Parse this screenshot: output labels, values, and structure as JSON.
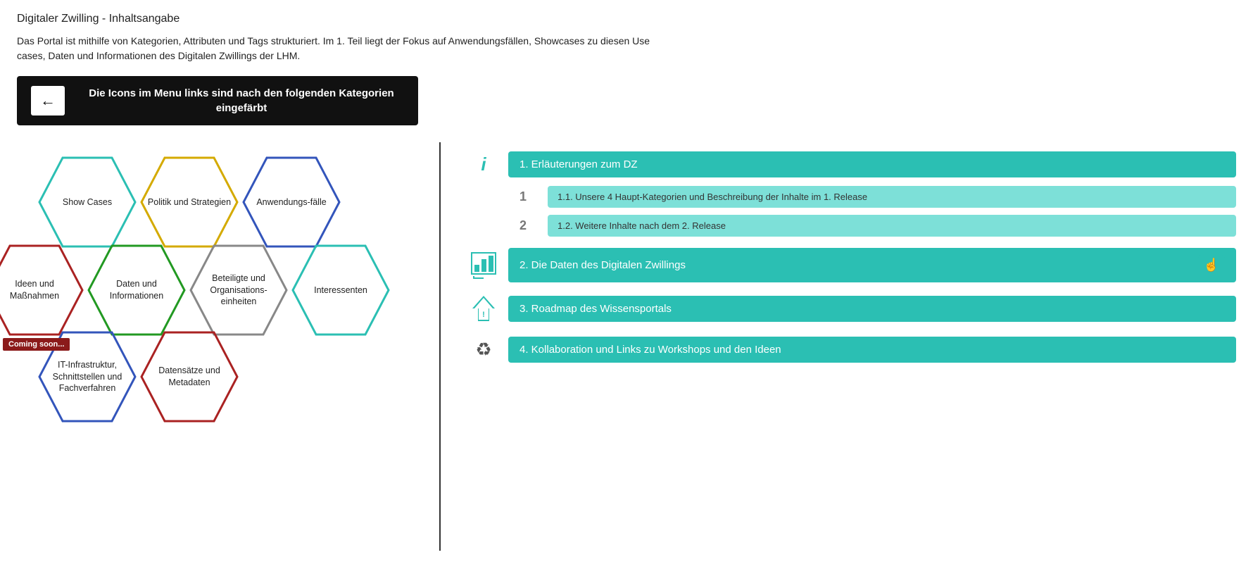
{
  "header": {
    "title": "Digitaler Zwilling - Inhaltsangabe"
  },
  "intro": {
    "text": "Das Portal ist mithilfe von Kategorien, Attributen und Tags strukturiert. Im 1. Teil liegt der Fokus auf Anwendungsfällen, Showcases zu diesen Use cases, Daten und Informationen des Digitalen Zwillings der LHM."
  },
  "banner": {
    "arrow_symbol": "←",
    "text": "Die Icons im Menu links sind nach den folgenden Kategorien eingefärbt"
  },
  "hexagons": [
    {
      "id": "show-cases",
      "label": "Show Cases",
      "color": "#2bbfb3",
      "filled": false
    },
    {
      "id": "politik",
      "label": "Politik und Strategien",
      "color": "#d4aa00",
      "filled": false
    },
    {
      "id": "anwendung",
      "label": "Anwendungs-fälle",
      "color": "#3355bb",
      "filled": false
    },
    {
      "id": "ideen",
      "label": "Ideen und Maßnahmen",
      "color": "#aa2222",
      "filled": false
    },
    {
      "id": "daten",
      "label": "Daten und Informationen",
      "color": "#229922",
      "filled": false
    },
    {
      "id": "beteiligte",
      "label": "Beteiligte und Organisations-einheiten",
      "color": "#888888",
      "filled": false
    },
    {
      "id": "interessenten",
      "label": "Interessenten",
      "color": "#2bbfb3",
      "filled": false
    },
    {
      "id": "it-infra",
      "label": "IT-Infrastruktur, Schnittstellen und Fachverfahren",
      "color": "#3355bb",
      "filled": false
    },
    {
      "id": "datensaetze",
      "label": "Datensätze und Metadaten",
      "color": "#aa2222",
      "filled": false
    }
  ],
  "coming_soon": "Coming soon...",
  "toc": {
    "items": [
      {
        "id": "item-1",
        "icon_type": "info",
        "label": "1. Erläuterungen zum DZ",
        "sub_items": [
          {
            "id": "sub-1-1",
            "number": "1",
            "label": "1.1. Unsere 4 Haupt-Kategorien und Beschreibung der Inhalte im 1. Release"
          },
          {
            "id": "sub-1-2",
            "number": "2",
            "label": "1.2. Weitere Inhalte nach dem 2. Release"
          }
        ]
      },
      {
        "id": "item-2",
        "icon_type": "bar-chart",
        "label": "2. Die Daten des Digitalen Zwillings",
        "has_finger": true
      },
      {
        "id": "item-3",
        "icon_type": "arrow-up",
        "label": "3. Roadmap des Wissensportals"
      },
      {
        "id": "item-4",
        "icon_type": "recycle",
        "label": "4. Kollaboration und Links zu Workshops und den Ideen"
      }
    ]
  }
}
